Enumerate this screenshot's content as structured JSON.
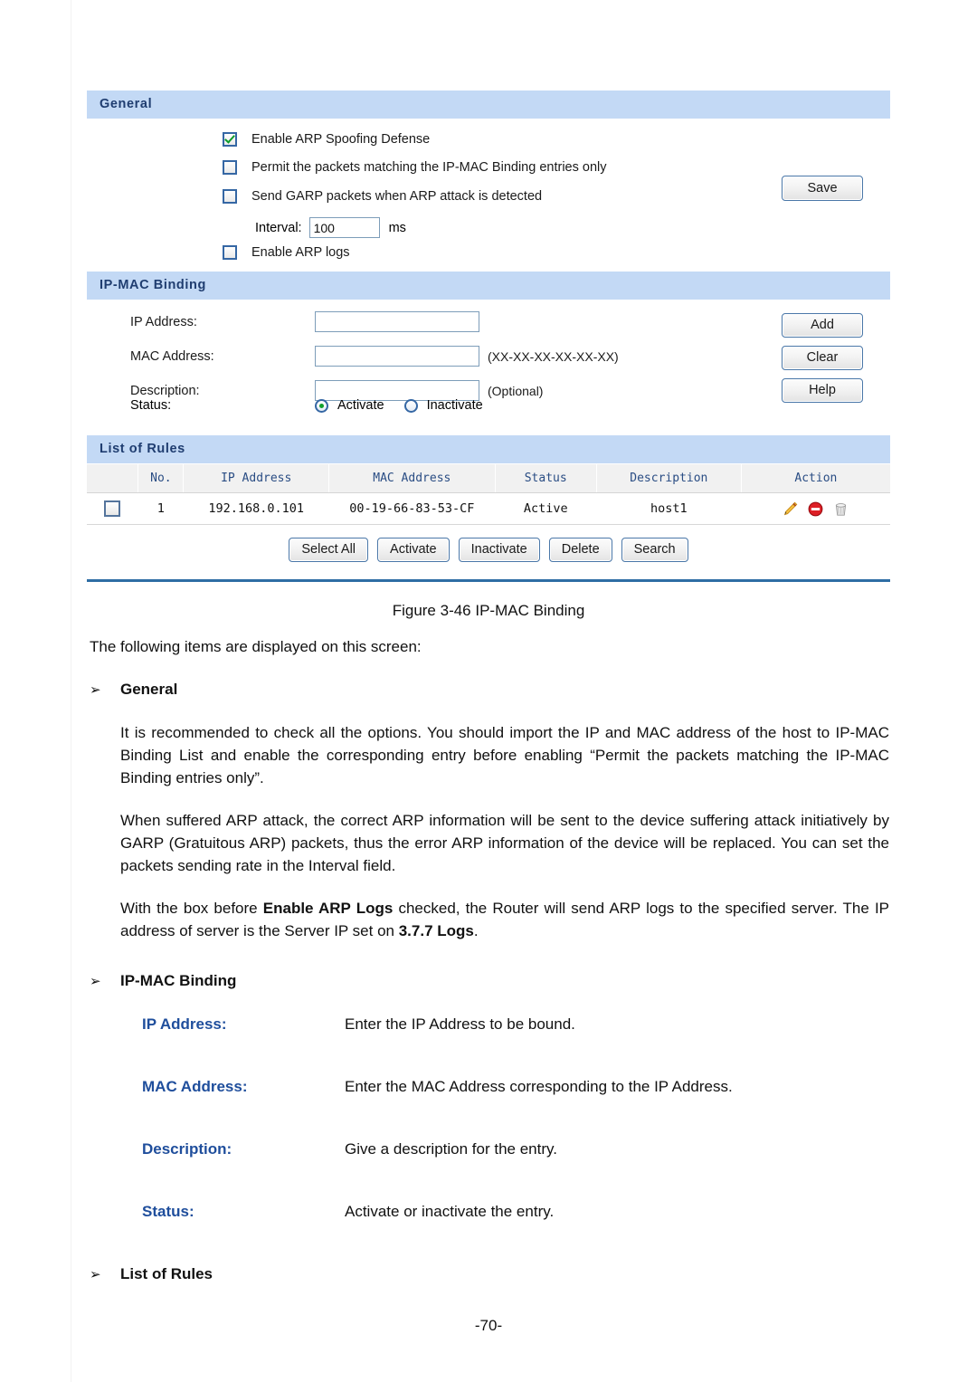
{
  "figure": {
    "general": {
      "panel_title": "General",
      "options": [
        {
          "label": "Enable ARP Spoofing Defense",
          "checked": true
        },
        {
          "label": "Permit the packets matching the IP-MAC Binding entries only",
          "checked": false
        },
        {
          "label": "Send GARP packets when ARP attack is detected",
          "checked": false
        },
        {
          "label": "Enable ARP logs",
          "checked": false
        }
      ],
      "interval_label": "Interval:",
      "interval_value": "100",
      "interval_unit": "ms",
      "save_label": "Save"
    },
    "binding": {
      "panel_title": "IP-MAC Binding",
      "fields": [
        {
          "label": "IP Address:",
          "value": "",
          "hint": ""
        },
        {
          "label": "MAC Address:",
          "value": "",
          "hint": "(XX-XX-XX-XX-XX-XX)"
        },
        {
          "label": "Description:",
          "value": "",
          "hint": "(Optional)"
        }
      ],
      "status_label": "Status:",
      "status_options": [
        {
          "label": "Activate",
          "selected": true
        },
        {
          "label": "Inactivate",
          "selected": false
        }
      ],
      "buttons": [
        "Add",
        "Clear",
        "Help"
      ]
    },
    "rules": {
      "panel_title": "List of Rules",
      "columns": [
        "",
        "No.",
        "IP Address",
        "MAC Address",
        "Status",
        "Description",
        "Action"
      ],
      "rows": [
        {
          "selected": false,
          "no": "1",
          "ip": "192.168.0.101",
          "mac": "00-19-66-83-53-CF",
          "status": "Active",
          "description": "host1",
          "actions": [
            "edit-pencil-icon",
            "block-icon",
            "trash-icon"
          ]
        }
      ],
      "buttons": [
        "Select All",
        "Activate",
        "Inactivate",
        "Delete",
        "Search"
      ]
    },
    "colors": {
      "panel_header_bg": "#c3d9f5",
      "panel_header_text": "#1f3d70",
      "table_header_text": "#2a4d84",
      "rule_line": "#2e6da4",
      "term_text": "#1f4e9c",
      "check_green": "#0d9b2a",
      "pencil": "#f0a830",
      "block_red": "#dd1f26"
    }
  },
  "document": {
    "caption": "Figure 3-46 IP-MAC Binding",
    "intro": "The following items are displayed on this screen:",
    "arrow_glyph": "➢",
    "sections": [
      {
        "title": "General"
      },
      {
        "title": "IP-MAC Binding"
      },
      {
        "title": "List of Rules"
      }
    ],
    "general_paragraphs": [
      "It is recommended to check all the options. You should import the IP and MAC address of the host to IP-MAC Binding List and enable the corresponding entry before enabling “Permit the packets matching the IP-MAC Binding entries only”.",
      "When suffered ARP attack, the correct ARP information will be sent to the device suffering attack initiatively by GARP (Gratuitous ARP) packets, thus the error ARP information of the device will be replaced. You can set the packets sending rate in the Interval field."
    ],
    "arp_logs_paragraph": {
      "part1": "With the box before ",
      "bold1": "Enable ARP Logs",
      "part2": " checked, the Router will send ARP logs to the specified server. The IP address of server is the Server IP set on ",
      "bold2": "3.7.7 Logs",
      "part3": "."
    },
    "definitions": [
      {
        "term": "IP Address:",
        "desc": "Enter the IP Address to be bound."
      },
      {
        "term": "MAC Address:",
        "desc": "Enter the MAC Address corresponding to the IP Address."
      },
      {
        "term": "Description:",
        "desc": "Give a description for the entry."
      },
      {
        "term": "Status:",
        "desc": "Activate or inactivate the entry."
      }
    ],
    "page_number": "-70-"
  }
}
